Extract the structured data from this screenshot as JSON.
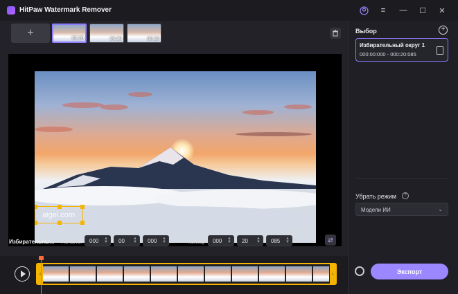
{
  "app": {
    "title": "HitPaw Watermark Remover"
  },
  "thumbnails": [
    {
      "duration": "00:20",
      "selected": true
    },
    {
      "duration": "00:20",
      "selected": false
    },
    {
      "duration": "00:20",
      "selected": false
    }
  ],
  "add_button": "+",
  "preview": {
    "watermark_text": "aigei.com"
  },
  "controls": {
    "selection_label": "Избирательны...",
    "start_label": "Начало:",
    "start": [
      "000",
      "00",
      "000"
    ],
    "end_label": "Конец:",
    "end": [
      "000",
      "20",
      "085"
    ]
  },
  "panel": {
    "title": "Выбор",
    "selection": {
      "name": "Избирательный округ 1",
      "time": "000:00:000 - 000:20:085"
    },
    "mode_title": "Убрать режим",
    "mode_value": "Модели ИИ",
    "export_label": "Экспорт"
  },
  "colors": {
    "accent": "#9b87ff",
    "selection_border": "#f5b400"
  }
}
